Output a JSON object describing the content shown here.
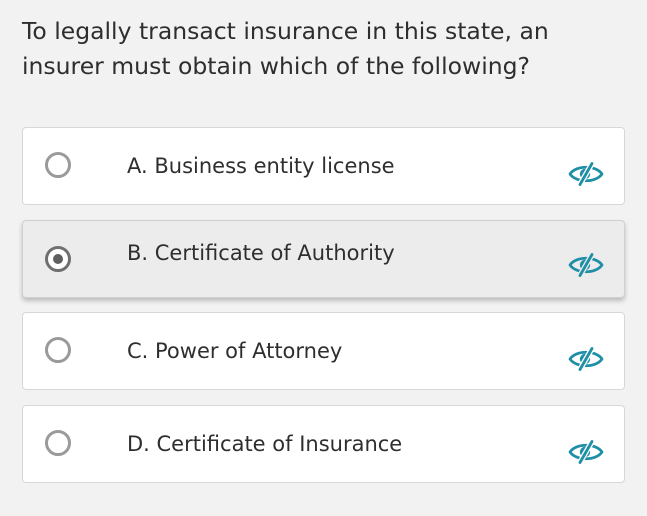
{
  "question": {
    "text": "To legally transact insurance in this state, an insurer must obtain which of the following?"
  },
  "options": [
    {
      "label": "A. Business entity license",
      "selected": false
    },
    {
      "label": "B. Certificate of Authority",
      "selected": true
    },
    {
      "label": "C. Power of Attorney",
      "selected": false
    },
    {
      "label": "D. Certificate of Insurance",
      "selected": false
    }
  ],
  "icons": {
    "radio": "radio-button-icon",
    "eliminate": "eye-slash-icon"
  },
  "colors": {
    "accent": "#1e8fa6",
    "page_background": "#f2f2f2",
    "selected_background": "#ececec"
  }
}
